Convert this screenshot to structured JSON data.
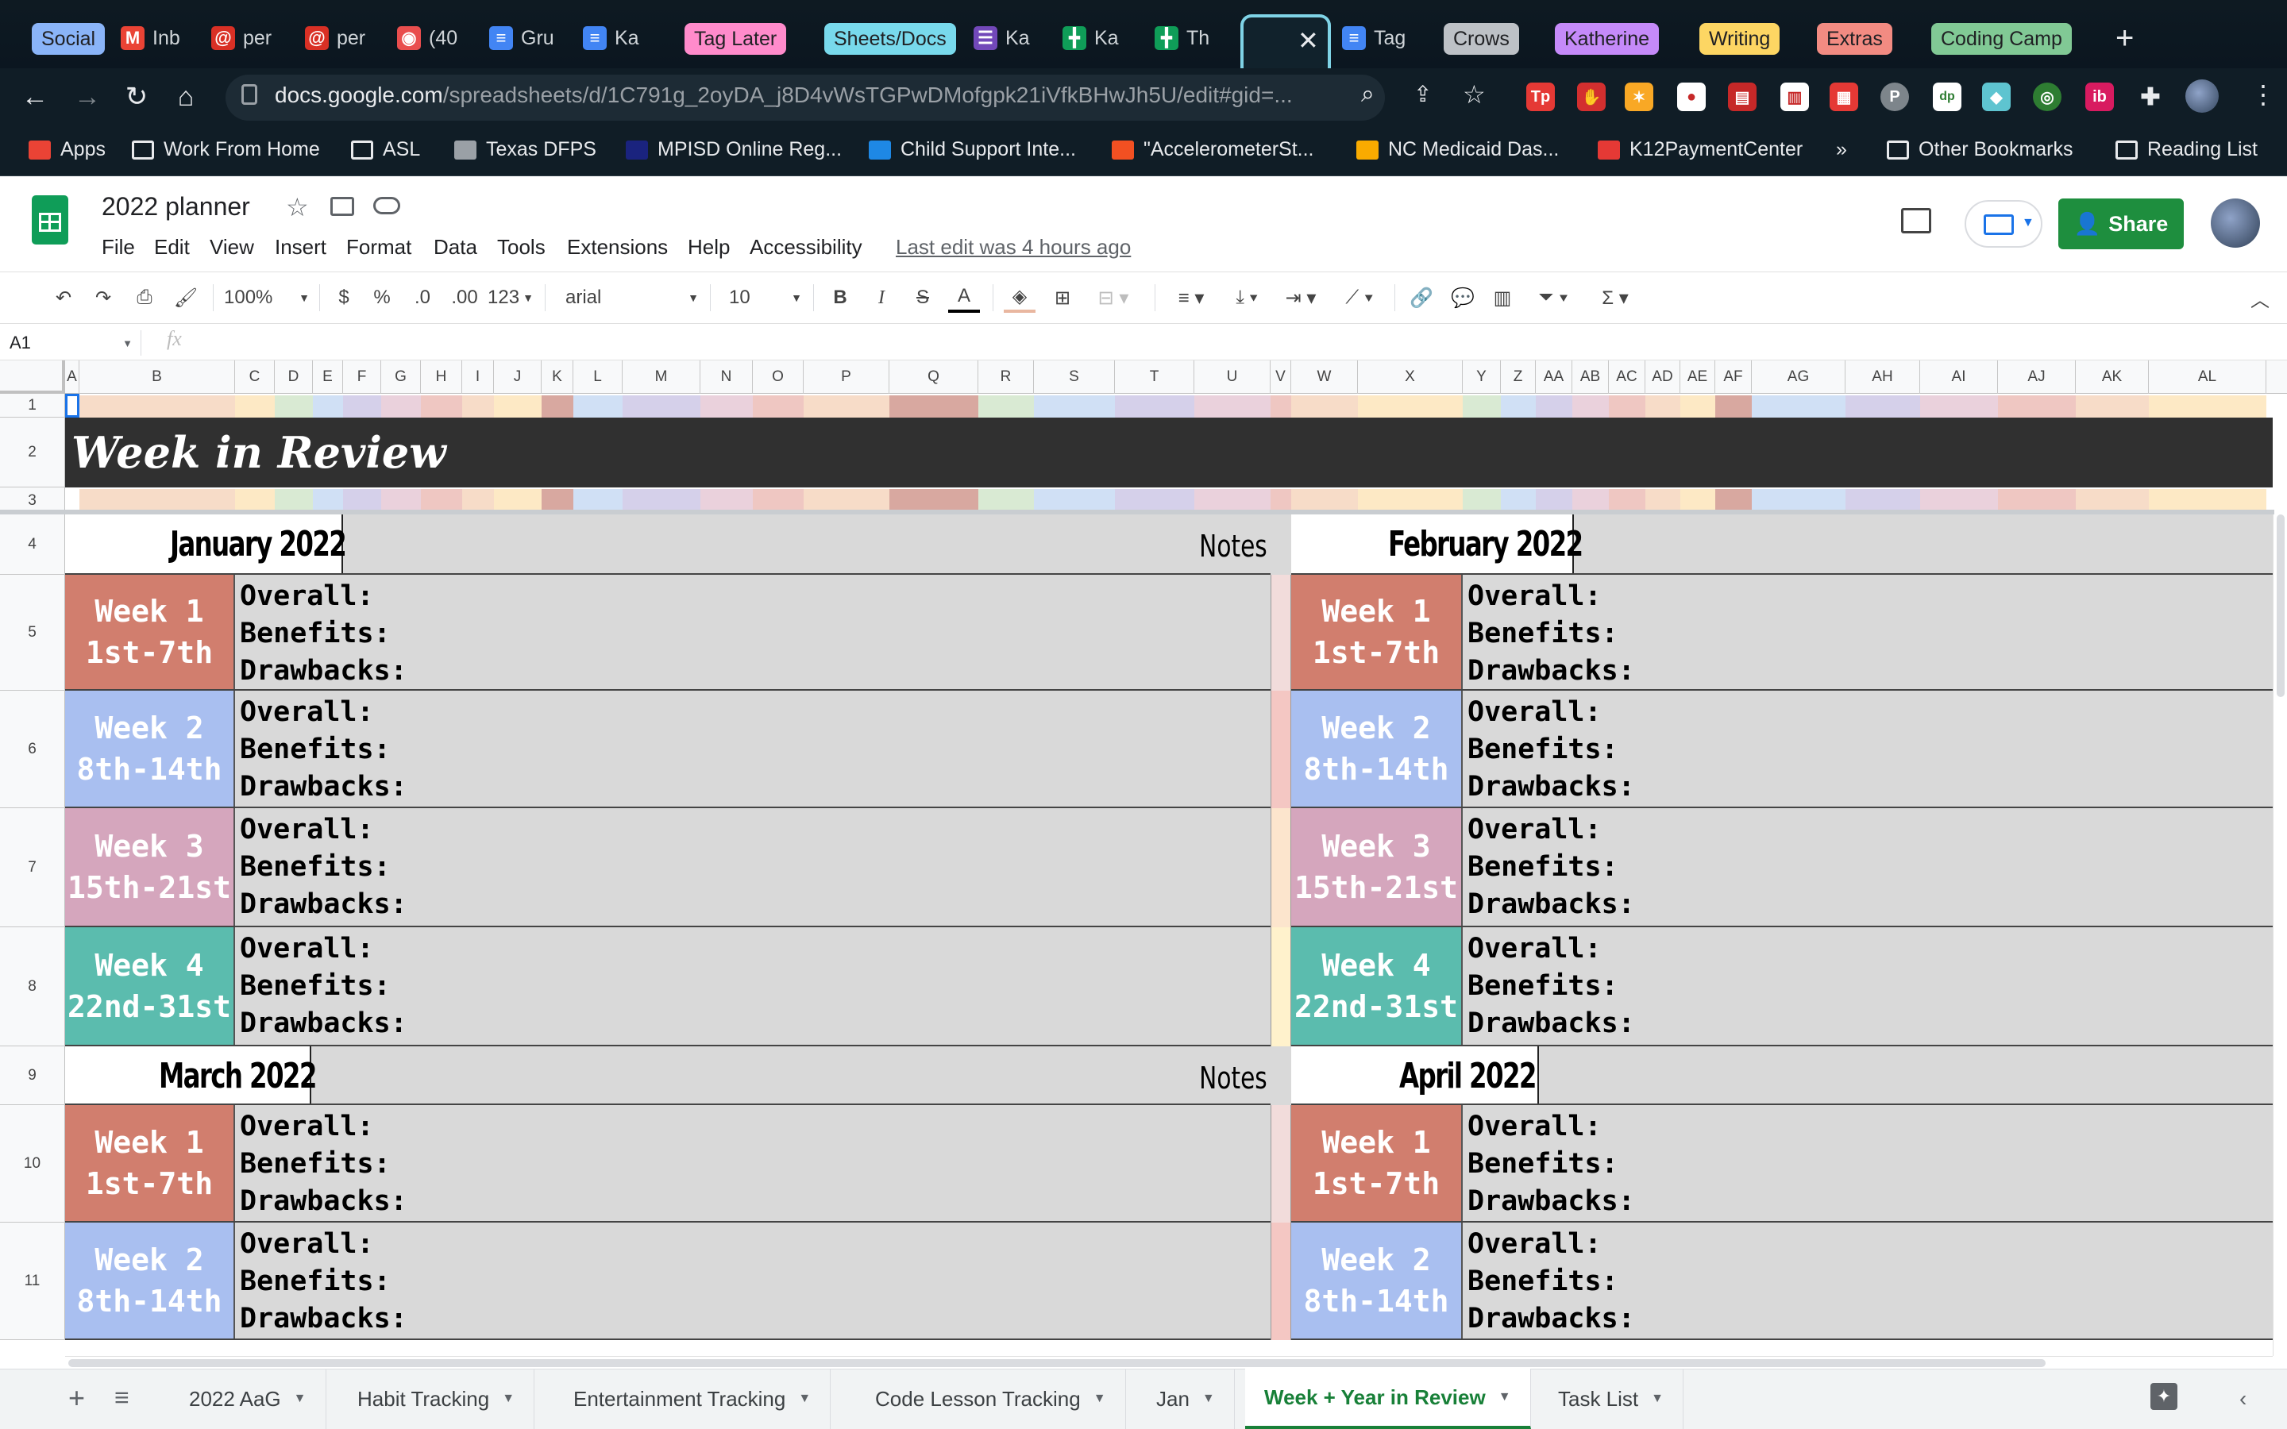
{
  "browser": {
    "tabs": [
      {
        "label": "Social",
        "kind": "group",
        "color": "#8ab4f8"
      },
      {
        "label": "Inb",
        "kind": "tab",
        "icon": "gmail-icon",
        "color": "#ea4335"
      },
      {
        "label": "per",
        "kind": "tab",
        "icon": "spiral-icon",
        "color": "#d93025"
      },
      {
        "label": "per",
        "kind": "tab",
        "icon": "spiral-icon",
        "color": "#d93025"
      },
      {
        "label": "(40",
        "kind": "tab",
        "icon": "app-icon",
        "color": "#e94e4e"
      },
      {
        "label": "Gru",
        "kind": "tab",
        "icon": "docs-icon",
        "color": "#4285f4"
      },
      {
        "label": "Ka",
        "kind": "tab",
        "icon": "docs-icon",
        "color": "#4285f4"
      },
      {
        "label": "Tag Later",
        "kind": "group",
        "color": "#ff8bcb"
      },
      {
        "label": "Sheets/Docs",
        "kind": "group",
        "color": "#78d9ec"
      },
      {
        "label": "Ka",
        "kind": "tab",
        "icon": "forms-icon",
        "color": "#7248b9"
      },
      {
        "label": "Ka",
        "kind": "tab",
        "icon": "sheets-icon",
        "color": "#0f9d58"
      },
      {
        "label": "Th",
        "kind": "tab",
        "icon": "sheets-icon",
        "color": "#0f9d58"
      },
      {
        "label": "",
        "kind": "active",
        "icon": "sheets-icon",
        "color": "#0f9d58"
      },
      {
        "label": "Tag",
        "kind": "tab",
        "icon": "docs-icon",
        "color": "#4285f4"
      },
      {
        "label": "Crows",
        "kind": "group",
        "color": "#bdc1c6"
      },
      {
        "label": "Katherine",
        "kind": "group",
        "color": "#c58af9"
      },
      {
        "label": "Writing",
        "kind": "group",
        "color": "#fdd663"
      },
      {
        "label": "Extras",
        "kind": "group",
        "color": "#f28b82"
      },
      {
        "label": "Coding Camp",
        "kind": "group",
        "color": "#81c995"
      }
    ],
    "url_domain": "docs.google.com",
    "url_path": "/spreadsheets/d/1C791g_2oyDA_j8D4vWsTGPwDMofgpk21iVfkBHwJh5U/edit#gid=...",
    "bookmarks": [
      {
        "label": "Apps",
        "icon": "apps-grid-icon"
      },
      {
        "label": "Work From Home",
        "icon": "folder-icon"
      },
      {
        "label": "ASL",
        "icon": "folder-icon"
      },
      {
        "label": "Texas DFPS",
        "icon": "dfps-icon"
      },
      {
        "label": "MPISD Online Reg...",
        "icon": "enr-icon"
      },
      {
        "label": "Child Support Inte...",
        "icon": "cloud-icon"
      },
      {
        "label": "\"AccelerometerSt...",
        "icon": "microsoft-icon"
      },
      {
        "label": "NC Medicaid Das...",
        "icon": "medicaid-icon"
      },
      {
        "label": "K12PaymentCenter",
        "icon": "k12-icon"
      },
      {
        "label": "»",
        "icon": ""
      },
      {
        "label": "Other Bookmarks",
        "icon": "folder-icon"
      },
      {
        "label": "Reading List",
        "icon": "reading-list-icon"
      }
    ]
  },
  "doc": {
    "title": "2022 planner",
    "menus": [
      "File",
      "Edit",
      "View",
      "Insert",
      "Format",
      "Data",
      "Tools",
      "Extensions",
      "Help",
      "Accessibility"
    ],
    "last_edit": "Last edit was 4 hours ago",
    "share_label": "Share"
  },
  "toolbar": {
    "zoom": "100%",
    "currency": "$",
    "percent": "%",
    "dec_less": ".0",
    "dec_more": ".00",
    "format_more": "123",
    "font": "arial",
    "font_size": "10"
  },
  "formula_bar": {
    "cell_ref": "A1",
    "fx": "fx",
    "value": ""
  },
  "columns": [
    "A",
    "B",
    "C",
    "D",
    "E",
    "F",
    "G",
    "H",
    "I",
    "J",
    "K",
    "L",
    "M",
    "N",
    "O",
    "P",
    "Q",
    "R",
    "S",
    "T",
    "U",
    "V",
    "W",
    "X",
    "Y",
    "Z",
    "AA",
    "AB",
    "AC",
    "AD",
    "AE",
    "AF",
    "AG",
    "AH",
    "AI",
    "AJ",
    "AK",
    "AL"
  ],
  "rows": [
    "1",
    "2",
    "3",
    "4",
    "5",
    "6",
    "7",
    "8",
    "9",
    "10",
    "11"
  ],
  "sheet": {
    "banner": "Week in Review",
    "notes_label": "Notes",
    "review_lines": "Overall:\nBenefits:\nDrawbacks:",
    "months": [
      {
        "name": "January 2022",
        "side": "left",
        "block": 0
      },
      {
        "name": "February 2022",
        "side": "right",
        "block": 0
      },
      {
        "name": "March 2022",
        "side": "left",
        "block": 1
      },
      {
        "name": "April 2022",
        "side": "right",
        "block": 1
      }
    ],
    "weeks": [
      {
        "label": "Week 1",
        "range": "1st-7th",
        "color": "#d17e6e"
      },
      {
        "label": "Week 2",
        "range": "8th-14th",
        "color": "#a9bff0"
      },
      {
        "label": "Week 3",
        "range": "15th-21st",
        "color": "#d5a6bd"
      },
      {
        "label": "Week 4",
        "range": "22nd-31st",
        "color": "#5bbcae"
      }
    ]
  },
  "sheet_tabs": [
    "2022 AaG",
    "Habit Tracking",
    "Entertainment Tracking",
    "Code Lesson Tracking",
    "Jan",
    "Week + Year in Review",
    "Task List"
  ],
  "active_sheet_tab": "Week + Year in Review"
}
